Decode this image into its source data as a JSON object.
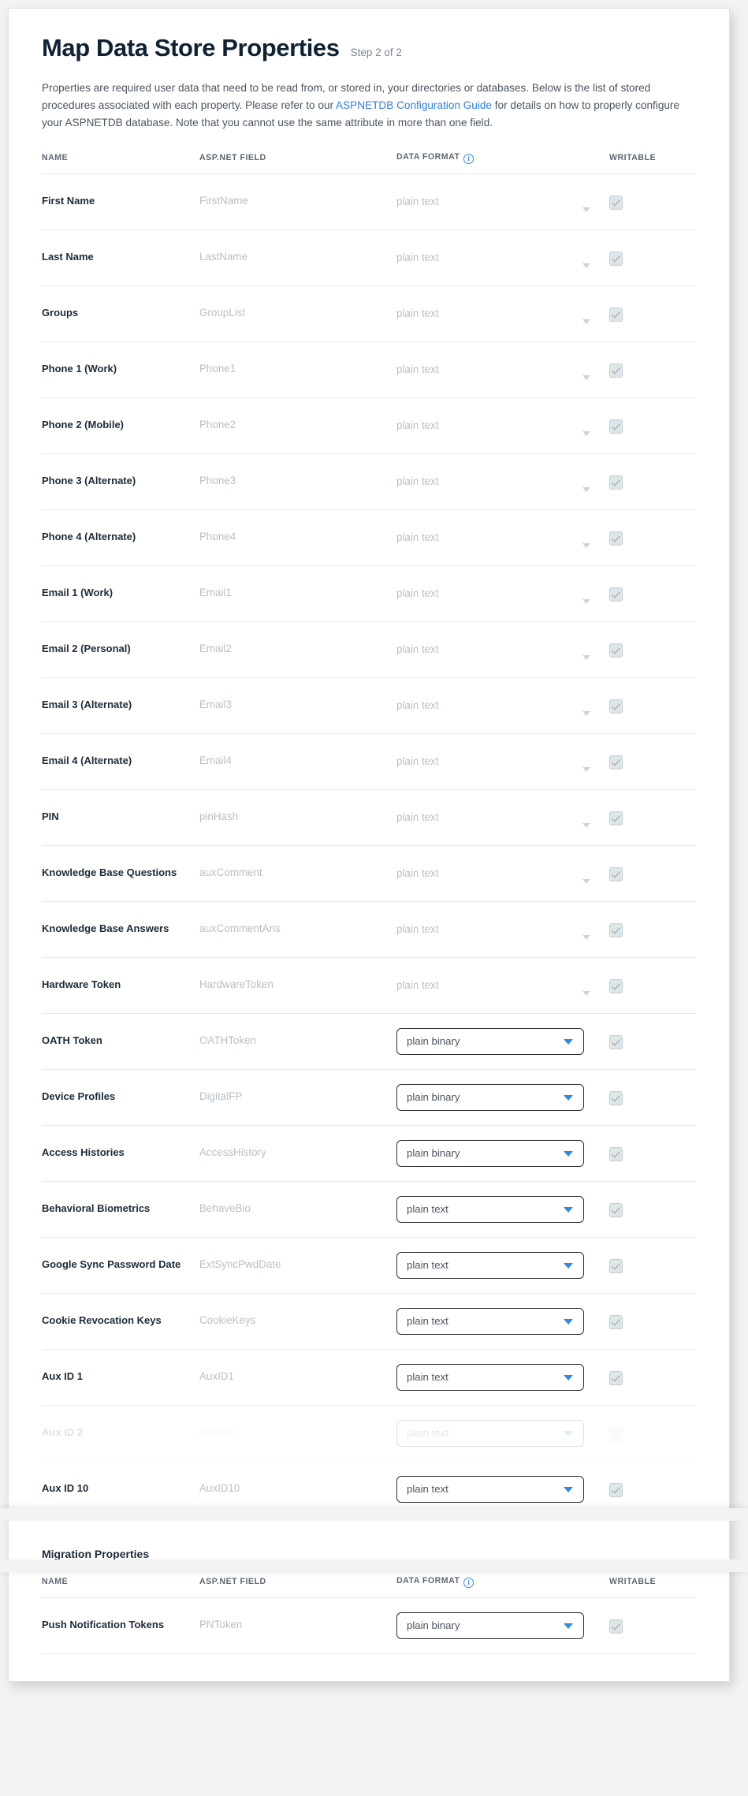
{
  "header": {
    "title": "Map Data Store Properties",
    "step": "Step 2 of 2",
    "intro_part1": "Properties are required user data that need to be read from, or stored in, your directories or databases. Below is the list of stored procedures associated with each property. Please refer to our ",
    "intro_link": "ASPNETDB Configuration Guide",
    "intro_part2": " for details on how to properly configure your ASPNETDB database. Note that you cannot use the same attribute in more than one field."
  },
  "columns": {
    "name": "NAME",
    "field": "ASP.NET FIELD",
    "format": "DATA FORMAT",
    "writable": "WRITABLE",
    "info_glyph": "i"
  },
  "colors": {
    "link": "#2f7fe0",
    "caret_active": "#2b8aea",
    "info": "#3b8ae8",
    "title": "#0f2133",
    "placeholder": "#b9bfc6"
  },
  "rows": [
    {
      "name": "First Name",
      "field": "FirstName",
      "format": "plain text",
      "enabled": false,
      "writable": true
    },
    {
      "name": "Last Name",
      "field": "LastName",
      "format": "plain text",
      "enabled": false,
      "writable": true
    },
    {
      "name": "Groups",
      "field": "GroupList",
      "format": "plain text",
      "enabled": false,
      "writable": true
    },
    {
      "name": "Phone 1 (Work)",
      "field": "Phone1",
      "format": "plain text",
      "enabled": false,
      "writable": true
    },
    {
      "name": "Phone 2 (Mobile)",
      "field": "Phone2",
      "format": "plain text",
      "enabled": false,
      "writable": true
    },
    {
      "name": "Phone 3 (Alternate)",
      "field": "Phone3",
      "format": "plain text",
      "enabled": false,
      "writable": true
    },
    {
      "name": "Phone 4 (Alternate)",
      "field": "Phone4",
      "format": "plain text",
      "enabled": false,
      "writable": true
    },
    {
      "name": "Email 1 (Work)",
      "field": "Email1",
      "format": "plain text",
      "enabled": false,
      "writable": true
    },
    {
      "name": "Email 2 (Personal)",
      "field": "Email2",
      "format": "plain text",
      "enabled": false,
      "writable": true
    },
    {
      "name": "Email 3 (Alternate)",
      "field": "Email3",
      "format": "plain text",
      "enabled": false,
      "writable": true
    },
    {
      "name": "Email 4 (Alternate)",
      "field": "Email4",
      "format": "plain text",
      "enabled": false,
      "writable": true
    },
    {
      "name": "PIN",
      "field": "pinHash",
      "format": "plain text",
      "enabled": false,
      "writable": true
    },
    {
      "name": "Knowledge Base Questions",
      "field": "auxComment",
      "format": "plain text",
      "enabled": false,
      "writable": true
    },
    {
      "name": "Knowledge Base Answers",
      "field": "auxCommentAns",
      "format": "plain text",
      "enabled": false,
      "writable": true
    },
    {
      "name": "Hardware Token",
      "field": "HardwareToken",
      "format": "plain text",
      "enabled": false,
      "writable": true
    },
    {
      "name": "OATH Token",
      "field": "OATHToken",
      "format": "plain binary",
      "enabled": true,
      "writable": true
    },
    {
      "name": "Device Profiles",
      "field": "DigitalFP",
      "format": "plain binary",
      "enabled": true,
      "writable": true
    },
    {
      "name": "Access Histories",
      "field": "AccessHistory",
      "format": "plain binary",
      "enabled": true,
      "writable": true
    },
    {
      "name": "Behavioral Biometrics",
      "field": "BehaveBio",
      "format": "plain text",
      "enabled": true,
      "writable": true
    },
    {
      "name": "Google Sync Password Date",
      "field": "ExtSyncPwdDate",
      "format": "plain text",
      "enabled": true,
      "writable": true
    },
    {
      "name": "Cookie Revocation Keys",
      "field": "CookieKeys",
      "format": "plain text",
      "enabled": true,
      "writable": true
    },
    {
      "name": "Aux ID 1",
      "field": "AuxID1",
      "format": "plain text",
      "enabled": true,
      "writable": true
    },
    {
      "name": "Aux ID 2",
      "field": "AuxID2",
      "format": "plain text",
      "enabled": true,
      "writable": true,
      "clipped": true
    },
    {
      "name": "Aux ID 10",
      "field": "AuxID10",
      "format": "plain text",
      "enabled": true,
      "writable": true
    }
  ],
  "migration": {
    "section_title": "Migration Properties",
    "rows": [
      {
        "name": "Push Notification Tokens",
        "field": "PNToken",
        "format": "plain binary",
        "enabled": true,
        "writable": true
      }
    ]
  }
}
